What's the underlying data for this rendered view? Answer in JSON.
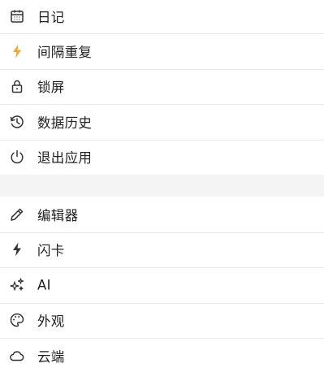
{
  "colors": {
    "accent_bolt": "#f5a623",
    "icon_default": "#333333",
    "divider": "#e9e9e9",
    "section_gap": "#f4f4f4"
  },
  "group1": {
    "items": [
      {
        "label": "日记",
        "icon": "calendar-icon"
      },
      {
        "label": "间隔重复",
        "icon": "lightning-bolt-icon"
      },
      {
        "label": "锁屏",
        "icon": "lock-icon"
      },
      {
        "label": "数据历史",
        "icon": "history-icon"
      },
      {
        "label": "退出应用",
        "icon": "power-icon"
      }
    ]
  },
  "group2": {
    "items": [
      {
        "label": "编辑器",
        "icon": "pencil-icon"
      },
      {
        "label": "闪卡",
        "icon": "lightning-bolt-icon"
      },
      {
        "label": "AI",
        "icon": "sparkles-icon"
      },
      {
        "label": "外观",
        "icon": "palette-icon"
      },
      {
        "label": "云端",
        "icon": "cloud-icon"
      }
    ]
  }
}
